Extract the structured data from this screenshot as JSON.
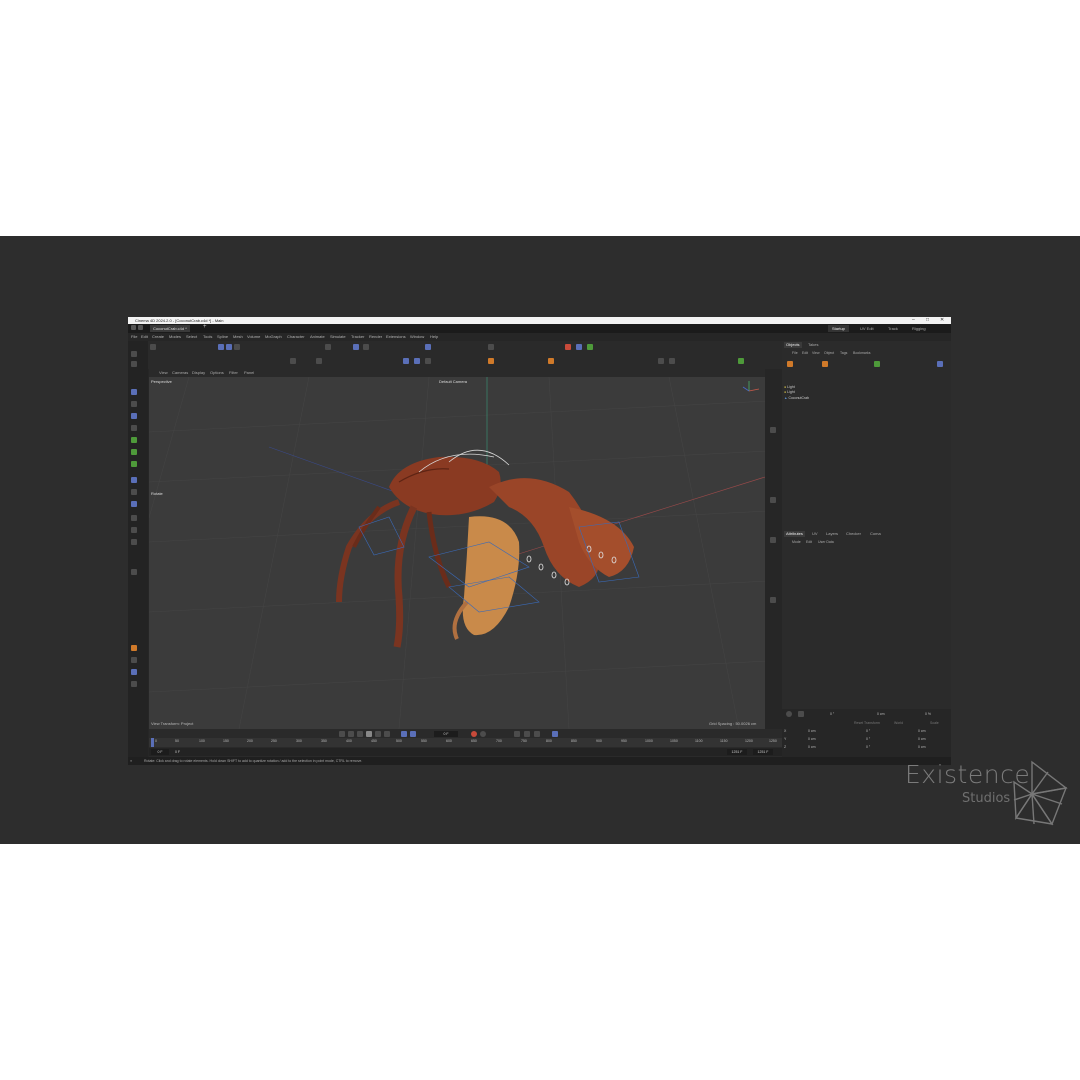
{
  "window": {
    "title": "Cinema 4D 2024.2.0 - [CoconutCrab.c4d *] - Main",
    "doc_tab": "CoconutCrab.c4d *",
    "new_tab": "+",
    "controls": {
      "minimize": "–",
      "maximize": "□",
      "close": "✕"
    }
  },
  "workspaces": [
    "Startup",
    "UV Edit",
    "Track",
    "Rigging"
  ],
  "menus": [
    "File",
    "Edit",
    "Create",
    "Modes",
    "Select",
    "Tools",
    "Spline",
    "Mesh",
    "Volume",
    "MoGraph",
    "Character",
    "Animate",
    "Simulate",
    "Tracker",
    "Render",
    "Extensions",
    "Window",
    "Help"
  ],
  "viewport": {
    "menu": [
      "View",
      "Cameras",
      "Display",
      "Options",
      "Filter",
      "Panel"
    ],
    "name": "Perspective",
    "camera": "Default Camera",
    "mode": "Rotate",
    "bottom_left": "View Transform: Project",
    "grid_spacing": "Grid Spacing : 50.0026 cm"
  },
  "timeline": {
    "current_frame": "0 F",
    "start": "0 F",
    "start2": "0 F",
    "end": "1251 F",
    "end2": "1251 F",
    "ruler": [
      "0",
      "50",
      "100",
      "150",
      "200",
      "250",
      "300",
      "350",
      "400",
      "450",
      "500",
      "550",
      "600",
      "650",
      "700",
      "750",
      "800",
      "850",
      "900",
      "950",
      "1000",
      "1050",
      "1100",
      "1150",
      "1200",
      "1250"
    ]
  },
  "objects_panel": {
    "tabs": [
      "Objects",
      "Takes"
    ],
    "menu": [
      "File",
      "Edit",
      "View",
      "Object",
      "Tags",
      "Bookmarks"
    ],
    "rows": [
      "Light",
      "Light",
      "CoconutCrab"
    ]
  },
  "attributes_panel": {
    "tabs": [
      "Attributes",
      "UV",
      "Layers",
      "Checker",
      "Coma"
    ],
    "menu": [
      "Mode",
      "Edit",
      "User Data"
    ]
  },
  "coords": {
    "row1": [
      "0 °",
      "0 cm",
      "0 %"
    ],
    "buttons": [
      "Reset Transform",
      "World",
      "Scale"
    ],
    "x": [
      "0 cm",
      "0 °",
      "0 cm"
    ],
    "y": [
      "0 cm",
      "0 °",
      "0 cm"
    ],
    "z": [
      "0 cm",
      "0 °",
      "0 cm"
    ],
    "axis_labels": [
      "X",
      "Y",
      "Z"
    ]
  },
  "status_bar": "Rotate: Click and drag to rotate elements. Hold down SHIFT to add to quantize rotation / add to the selection in point mode, CTRL to remove.",
  "watermark": {
    "title": "Existence",
    "subtitle": "Studios"
  },
  "colors": {
    "band": "#2d2d2d",
    "accent_blue": "#5a6fb8",
    "crab_shell": "#8a3a22",
    "crab_claw": "#c98a4a"
  }
}
